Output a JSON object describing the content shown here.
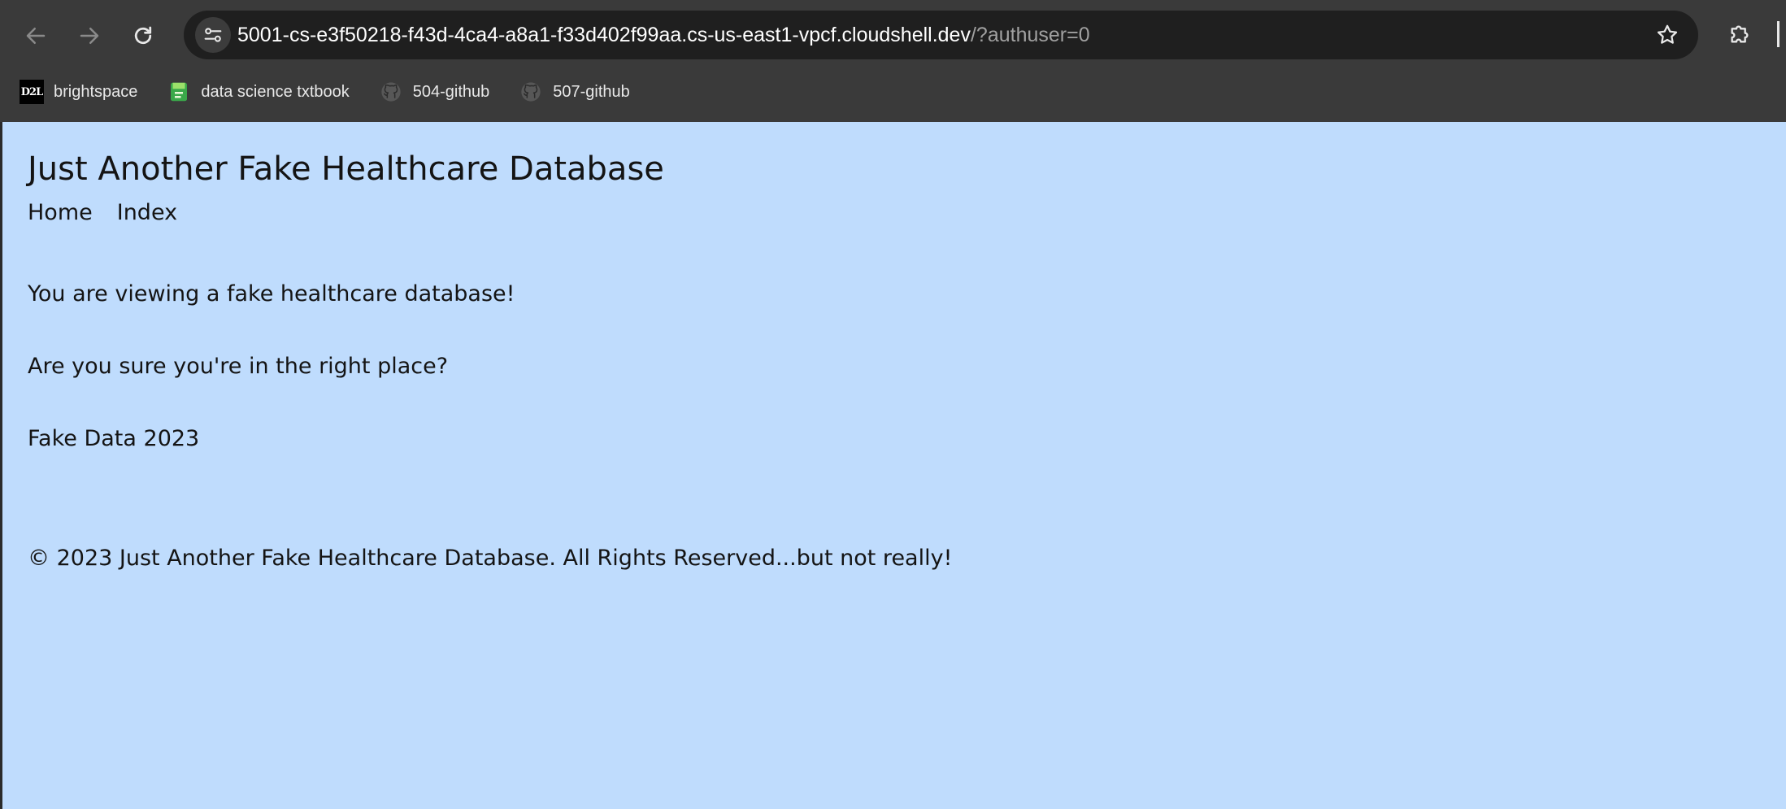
{
  "browser": {
    "url_host": "5001-cs-e3f50218-f43d-4ca4-a8a1-f33d402f99aa.cs-us-east1-vpcf.cloudshell.dev",
    "url_rest": "/?authuser=0",
    "icons": {
      "back": "arrow-left-icon",
      "forward": "arrow-right-icon",
      "reload": "reload-icon",
      "site_info": "tune-icon",
      "bookmark_star": "star-icon",
      "extensions": "puzzle-icon"
    },
    "bookmarks": [
      {
        "label": "brightspace",
        "icon": "d2l-logo",
        "logo_text": "D2L"
      },
      {
        "label": "data science txtbook",
        "icon": "book-icon"
      },
      {
        "label": "504-github",
        "icon": "github-icon"
      },
      {
        "label": "507-github",
        "icon": "github-icon"
      }
    ]
  },
  "page": {
    "title": "Just Another Fake Healthcare Database",
    "nav": [
      {
        "label": "Home"
      },
      {
        "label": "Index"
      }
    ],
    "paragraphs": [
      "You are viewing a fake healthcare database!",
      "Are you sure you're in the right place?",
      "Fake Data 2023"
    ],
    "footer": "© 2023 Just Another Fake Healthcare Database. All Rights Reserved...but not really!"
  },
  "colors": {
    "page_background": "#bfdcfd",
    "chrome_background": "#3a3a3a",
    "omnibox_background": "#1f1f1f",
    "text": "#141414"
  }
}
